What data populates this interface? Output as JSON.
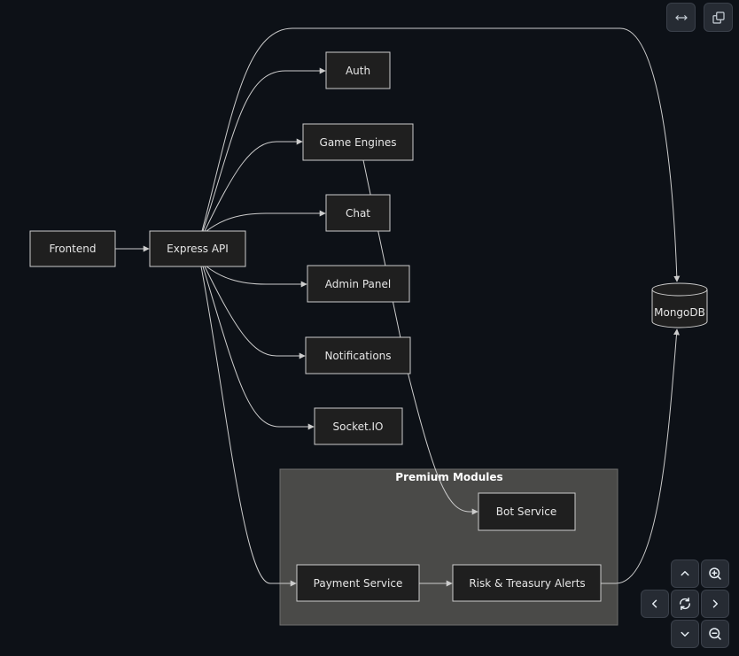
{
  "colors": {
    "background": "#0d1117",
    "node_fill": "#1f1f1f",
    "node_stroke": "#cccccc",
    "edge": "#cccccc",
    "group_fill": "#4a4a48",
    "group_stroke": "#6e6e6e"
  },
  "diagram": {
    "group_label": "Premium Modules",
    "nodes": {
      "frontend": "Frontend",
      "express_api": "Express API",
      "auth": "Auth",
      "game_engines": "Game Engines",
      "chat": "Chat",
      "admin_panel": "Admin Panel",
      "notifications": "Notifications",
      "socket_io": "Socket.IO",
      "bot_service": "Bot Service",
      "payment_service": "Payment Service",
      "risk_alerts": "Risk & Treasury Alerts",
      "mongodb": "MongoDB"
    }
  },
  "toolbar": {
    "fit_width_icon": "arrows-horizontal-icon",
    "copy_icon": "copy-icon"
  },
  "controls": {
    "zoom_in_icon": "zoom-in-icon",
    "zoom_out_icon": "zoom-out-icon",
    "pan_up_icon": "chevron-up-icon",
    "pan_down_icon": "chevron-down-icon",
    "pan_left_icon": "chevron-left-icon",
    "pan_right_icon": "chevron-right-icon",
    "reset_icon": "refresh-icon"
  }
}
